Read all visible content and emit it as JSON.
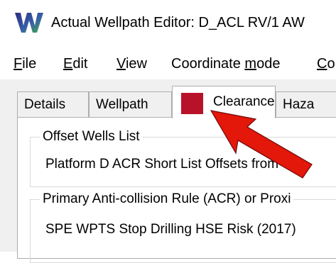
{
  "window": {
    "title": "Actual Wellpath Editor: D_ACL RV/1 AW"
  },
  "menu": {
    "items": [
      {
        "key": "F",
        "rest": "ile"
      },
      {
        "key": "E",
        "rest": "dit"
      },
      {
        "key": "V",
        "rest": "iew"
      },
      {
        "pre": "Coordinate ",
        "key": "m",
        "rest": "ode"
      },
      {
        "key": "C",
        "rest": "o"
      }
    ]
  },
  "tabs": {
    "details": "Details",
    "wellpath": "Wellpath",
    "clearance": "Clearance",
    "hazards": "Haza",
    "clearance_color": "#b8112a"
  },
  "offset_wells": {
    "title": "Offset Wells List",
    "value": "Platform D ACR Short List Offsets from"
  },
  "rule": {
    "title": "Primary Anti-collision Rule (ACR) or Proxi",
    "value": "SPE WPTS Stop Drilling HSE Risk (2017)"
  },
  "annotation": {
    "arrow_color": "#e3170a"
  }
}
